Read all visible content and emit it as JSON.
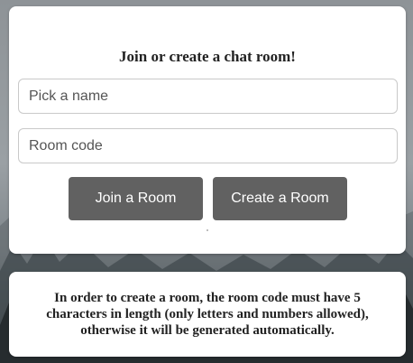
{
  "join_form": {
    "title": "Join or create a chat room!",
    "name_placeholder": "Pick a name",
    "code_placeholder": "Room code",
    "join_label": "Join a Room",
    "create_label": "Create a Room"
  },
  "info": {
    "text": "In order to create a room, the room code must have 5 characters in length (only letters and numbers allowed), otherwise it will be generated automatically."
  },
  "colors": {
    "button": "#616161",
    "card": "#ffffff"
  }
}
